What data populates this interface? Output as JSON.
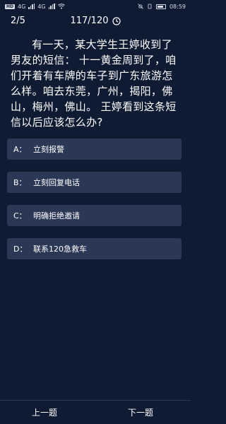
{
  "status_bar": {
    "left_pill": "HD",
    "network_1": "4G",
    "network_2": "4G",
    "time": "08:59"
  },
  "header": {
    "progress": "2/5",
    "timer": "117/120"
  },
  "question": {
    "text": "有一天，某大学生王婷收到了男友的短信： 十一黄金周到了，咱们开着有车牌的车子到广东旅游怎么样。咱去东莞，广州，揭阳，佛山，梅州，佛山。 王婷看到这条短信以后应该怎么办?"
  },
  "options": [
    {
      "letter": "A：",
      "text": "立刻报警"
    },
    {
      "letter": "B：",
      "text": "立刻回复电话"
    },
    {
      "letter": "C：",
      "text": "明确拒绝邀请"
    },
    {
      "letter": "D：",
      "text": "联系120急救车"
    }
  ],
  "footer": {
    "prev": "上一题",
    "next": "下一题"
  },
  "colors": {
    "background": "#0f1b33",
    "option_bg": "#2a3855",
    "text": "#ffffff"
  }
}
